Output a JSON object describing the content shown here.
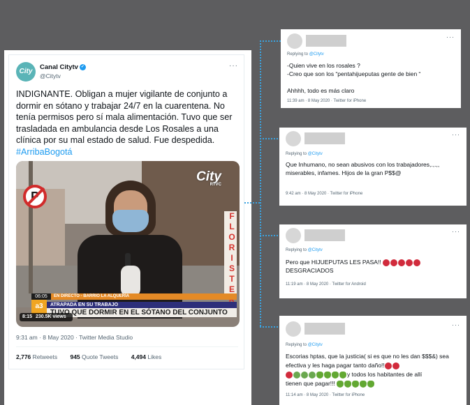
{
  "main_tweet": {
    "avatar_text": "City",
    "name": "Canal Citytv",
    "verified_glyph": "✓",
    "handle": "@Citytv",
    "more": "···",
    "text": "INDIGNANTE. Obligan a mujer vigilante de conjunto a dormir en sótano y trabajar 24/7 en la cuarentena. No tenía permisos pero sí mala alimentación. Tuvo que ser trasladada en ambulancia desde Los Rosales a una clínica por su mal estado de salud. Fue despedida.",
    "hashtag": "#ArribaBogotá",
    "video": {
      "channel_logo": "City",
      "channel_sub": "RTVC",
      "sign_letter": "P",
      "store_sign": "FLORISTER",
      "time": "06:05",
      "live_text": "EN DIRECTO - BARRIO LA ALQUERÍA",
      "brand_logo": "a3",
      "headline1": "ATRAPADA EN SU TRABAJO",
      "headline2": "TUVO QUE DORMIR EN EL SÓTANO DEL CONJUNTO",
      "duration": "8:15",
      "views": "230.5K views"
    },
    "meta": "9:31 am · 8 May 2020 · Twitter Media Studio",
    "retweets_count": "2,776",
    "retweets_label": "Retweets",
    "quotes_count": "945",
    "quotes_label": "Quote Tweets",
    "likes_count": "4,494",
    "likes_label": "Likes"
  },
  "replies": [
    {
      "replying_prefix": "Replying to",
      "replying_handle": "@Citytv",
      "text": "-Quien vive en los rosales ?\n-Creo que son los “pentahijueputas gente de bien “\n\nAhhhh, todo es más claro",
      "meta": "11:39 am · 8 May 2020 · Twitter for iPhone"
    },
    {
      "replying_prefix": "Replying to",
      "replying_handle": "@Citytv",
      "text": "Que Inhumano, no sean abusivos con los trabajadores,.,.,, miserables, infames. Hijos de la gran P$$@",
      "meta": "9:42 am · 8 May 2020 · Twitter for iPhone"
    },
    {
      "replying_prefix": "Replying to",
      "replying_handle": "@Citytv",
      "text1": "Pero que HIJUEPUTAS LES PASA!!",
      "text2": "DESGRACIADOS",
      "meta": "11:19 am · 8 May 2020 · Twitter for Android"
    },
    {
      "replying_prefix": "Replying to",
      "replying_handle": "@Citytv",
      "text1": "Escorias hptas, que la justicia( si es que no les dan $$$&) sea efectiva y les haga pagar tanto daño!!",
      "text2": "y todos los habitantes de allí",
      "text3": "tienen que pagar!!!",
      "meta": "11:14 am · 8 May 2020 · Twitter for iPhone"
    }
  ]
}
